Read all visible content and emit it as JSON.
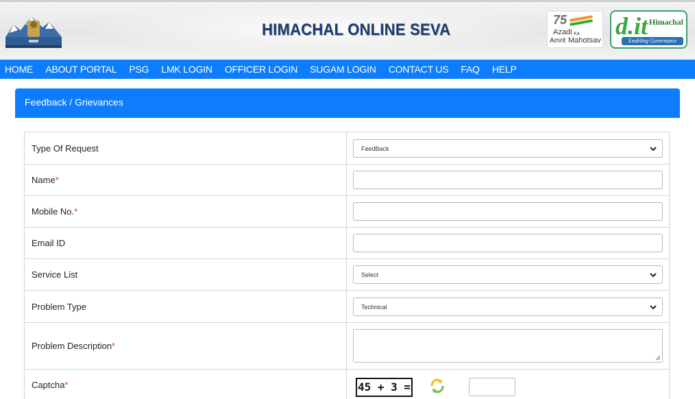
{
  "header": {
    "site_title": "HIMACHAL ONLINE SEVA",
    "azadi": {
      "num": "75",
      "line1": "Azadi",
      "line1b": "Ka",
      "line2": "Amrit",
      "line2b": "Mahotsav"
    },
    "dit": {
      "big": "d.it",
      "state": "Himachal",
      "tagline": "Enabling Governance"
    }
  },
  "nav": {
    "items": [
      "HOME",
      "ABOUT PORTAL",
      "PSG",
      "LMK LOGIN",
      "OFFICER LOGIN",
      "SUGAM LOGIN",
      "CONTACT US",
      "FAQ",
      "HELP"
    ]
  },
  "panel": {
    "title": "Feedback / Grievances"
  },
  "form": {
    "type_of_request": {
      "label": "Type Of Request",
      "value": "FeedBack"
    },
    "name": {
      "label": "Name",
      "required": "*"
    },
    "mobile": {
      "label": "Mobile No.",
      "required": "*"
    },
    "email": {
      "label": "Email ID"
    },
    "service_list": {
      "label": "Service List",
      "value": "Select"
    },
    "problem_type": {
      "label": "Problem Type",
      "value": "Technical"
    },
    "problem_description": {
      "label": "Problem Description",
      "required": "*"
    },
    "captcha": {
      "label": "Captcha",
      "required": "*",
      "question": "45 + 3 ="
    }
  },
  "colors": {
    "primary_blue": "#0d7dfd",
    "required_red": "#e0302a",
    "refresh_green": "#7bc143",
    "refresh_yellow": "#f2c018"
  },
  "icons": {
    "emblem": "himachal-emblem-icon",
    "chevron": "chevron-down-icon",
    "refresh": "refresh-icon",
    "resize": "resize-grip-icon"
  }
}
